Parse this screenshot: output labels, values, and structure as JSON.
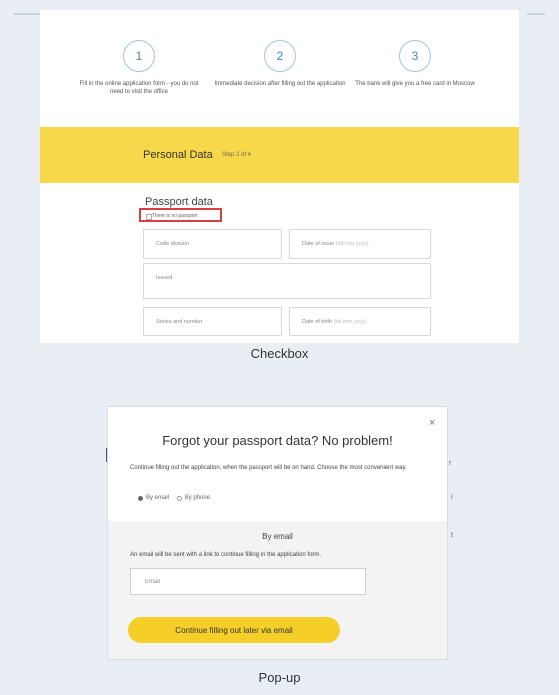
{
  "checkbox_screenshot": {
    "steps": [
      {
        "number": "1",
        "text": "Fill in the online application form - you do not need to visit the office"
      },
      {
        "number": "2",
        "text": "Immediate decision after filling out the application"
      },
      {
        "number": "3",
        "text": "The bank will give you a free card in Moscow"
      }
    ],
    "section_title": "Personal Data",
    "section_step": "Step 2 of 4",
    "passport_title": "Passport data",
    "no_passport_label": "There is no passport",
    "fields": {
      "code_division": "Code division",
      "date_of_issue": "Date of issue",
      "date_of_issue_hint": "(dd.mm.yyyy)",
      "issued": "Issued",
      "series_number": "Series and number",
      "date_of_birth": "Date of birth",
      "date_of_birth_hint": "(dd.mm.yyyy)"
    },
    "caption": "Checkbox"
  },
  "popup_screenshot": {
    "close_symbol": "×",
    "title": "Forgot your passport data? No problem!",
    "description": "Continue filling out the application, when the passport will be on hand. Choose the most convenient way.",
    "options": [
      {
        "label": "By email",
        "selected": true
      },
      {
        "label": "By phone",
        "selected": false
      }
    ],
    "email_heading": "By email",
    "email_description": "An email will be sent with a link to continue filling in the application form.",
    "email_placeholder": "Email",
    "button_label": "Continue filling out later via email",
    "caption": "Pop-up"
  }
}
